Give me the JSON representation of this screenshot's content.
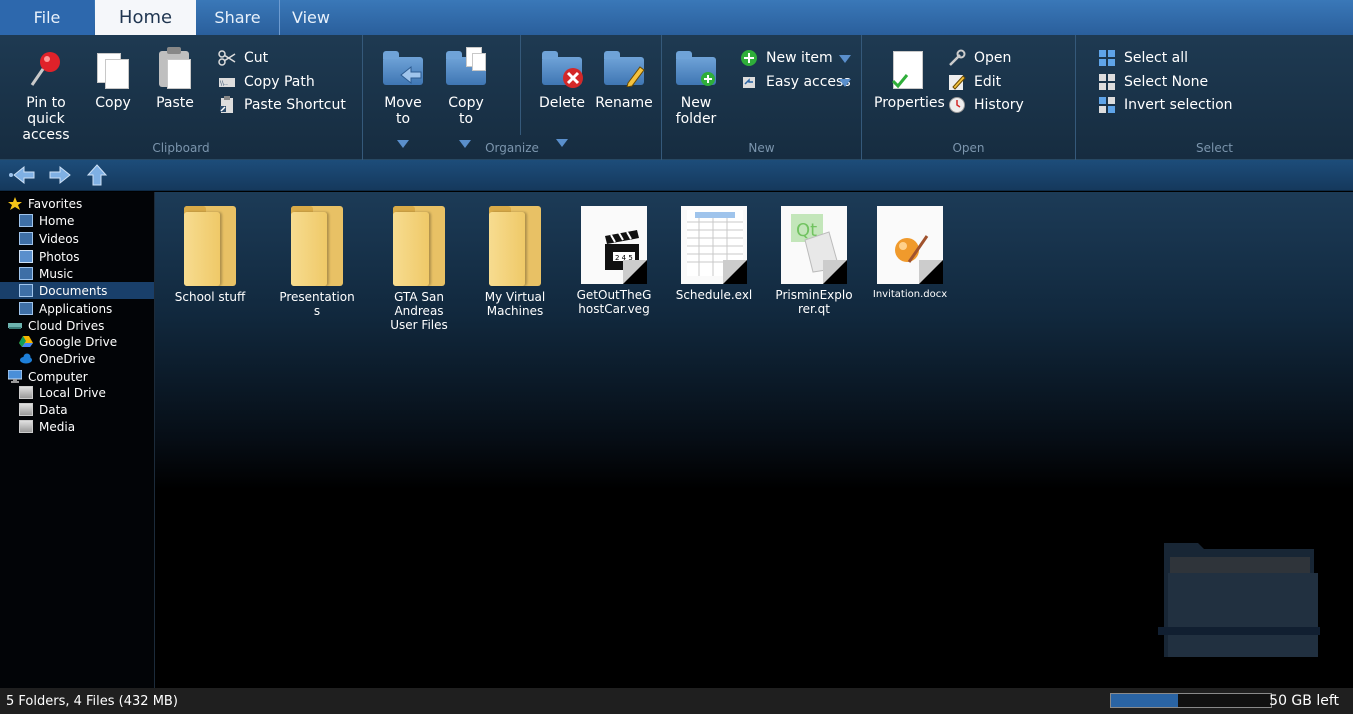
{
  "tabs": [
    {
      "label": "File"
    },
    {
      "label": "Home"
    },
    {
      "label": "Share"
    },
    {
      "label": "View"
    }
  ],
  "ribbon": {
    "clipboard": {
      "group_label": "Clipboard",
      "pin": "Pin to quick access",
      "pin_lines": [
        "Pin to",
        "quick",
        "access"
      ],
      "copy": "Copy",
      "paste": "Paste",
      "cut": "Cut",
      "copy_path": "Copy Path",
      "paste_shortcut": "Paste Shortcut"
    },
    "organize": {
      "group_label": "Organize",
      "move_to": [
        "Move",
        "to"
      ],
      "copy_to": [
        "Copy",
        "to"
      ],
      "delete": "Delete",
      "rename": "Rename"
    },
    "new": {
      "group_label": "New",
      "new_folder": [
        "New",
        "folder"
      ],
      "new_item": "New item",
      "easy_access": "Easy access"
    },
    "open": {
      "group_label": "Open",
      "properties": "Properties",
      "open": "Open",
      "edit": "Edit",
      "history": "History"
    },
    "select": {
      "group_label": "Select",
      "select_all": "Select all",
      "select_none": "Select None",
      "invert": "Invert selection"
    }
  },
  "sidebar": {
    "favorites": "Favorites",
    "fav_items": [
      "Home",
      "Videos",
      "Photos",
      "Music",
      "Documents",
      "Applications"
    ],
    "cloud": "Cloud Drives",
    "cloud_items": [
      "Google Drive",
      "OneDrive"
    ],
    "computer": "Computer",
    "computer_items": [
      "Local Drive",
      "Data",
      "Media"
    ],
    "selected": "Documents"
  },
  "files": [
    {
      "name": "School stuff",
      "kind": "folder"
    },
    {
      "name": "Presentations",
      "kind": "folder"
    },
    {
      "name": "GTA San Andreas User Files",
      "kind": "folder"
    },
    {
      "name": "My Virtual Machines",
      "kind": "folder"
    },
    {
      "name": "GetOutTheGhostCar.veg",
      "kind": "video"
    },
    {
      "name": "Schedule.exl",
      "kind": "sheet"
    },
    {
      "name": "PrisminExplorer.qt",
      "kind": "qt"
    },
    {
      "name": "Invitation.docx",
      "kind": "doc"
    }
  ],
  "status": {
    "summary": "5 Folders, 4 Files (432 MB)",
    "space_left": "50 GB left",
    "used_fraction": 0.42
  },
  "colors": {
    "accent": "#2a64a4",
    "ribbon": "#1e3a52",
    "selected_nav": "#193f6a"
  }
}
